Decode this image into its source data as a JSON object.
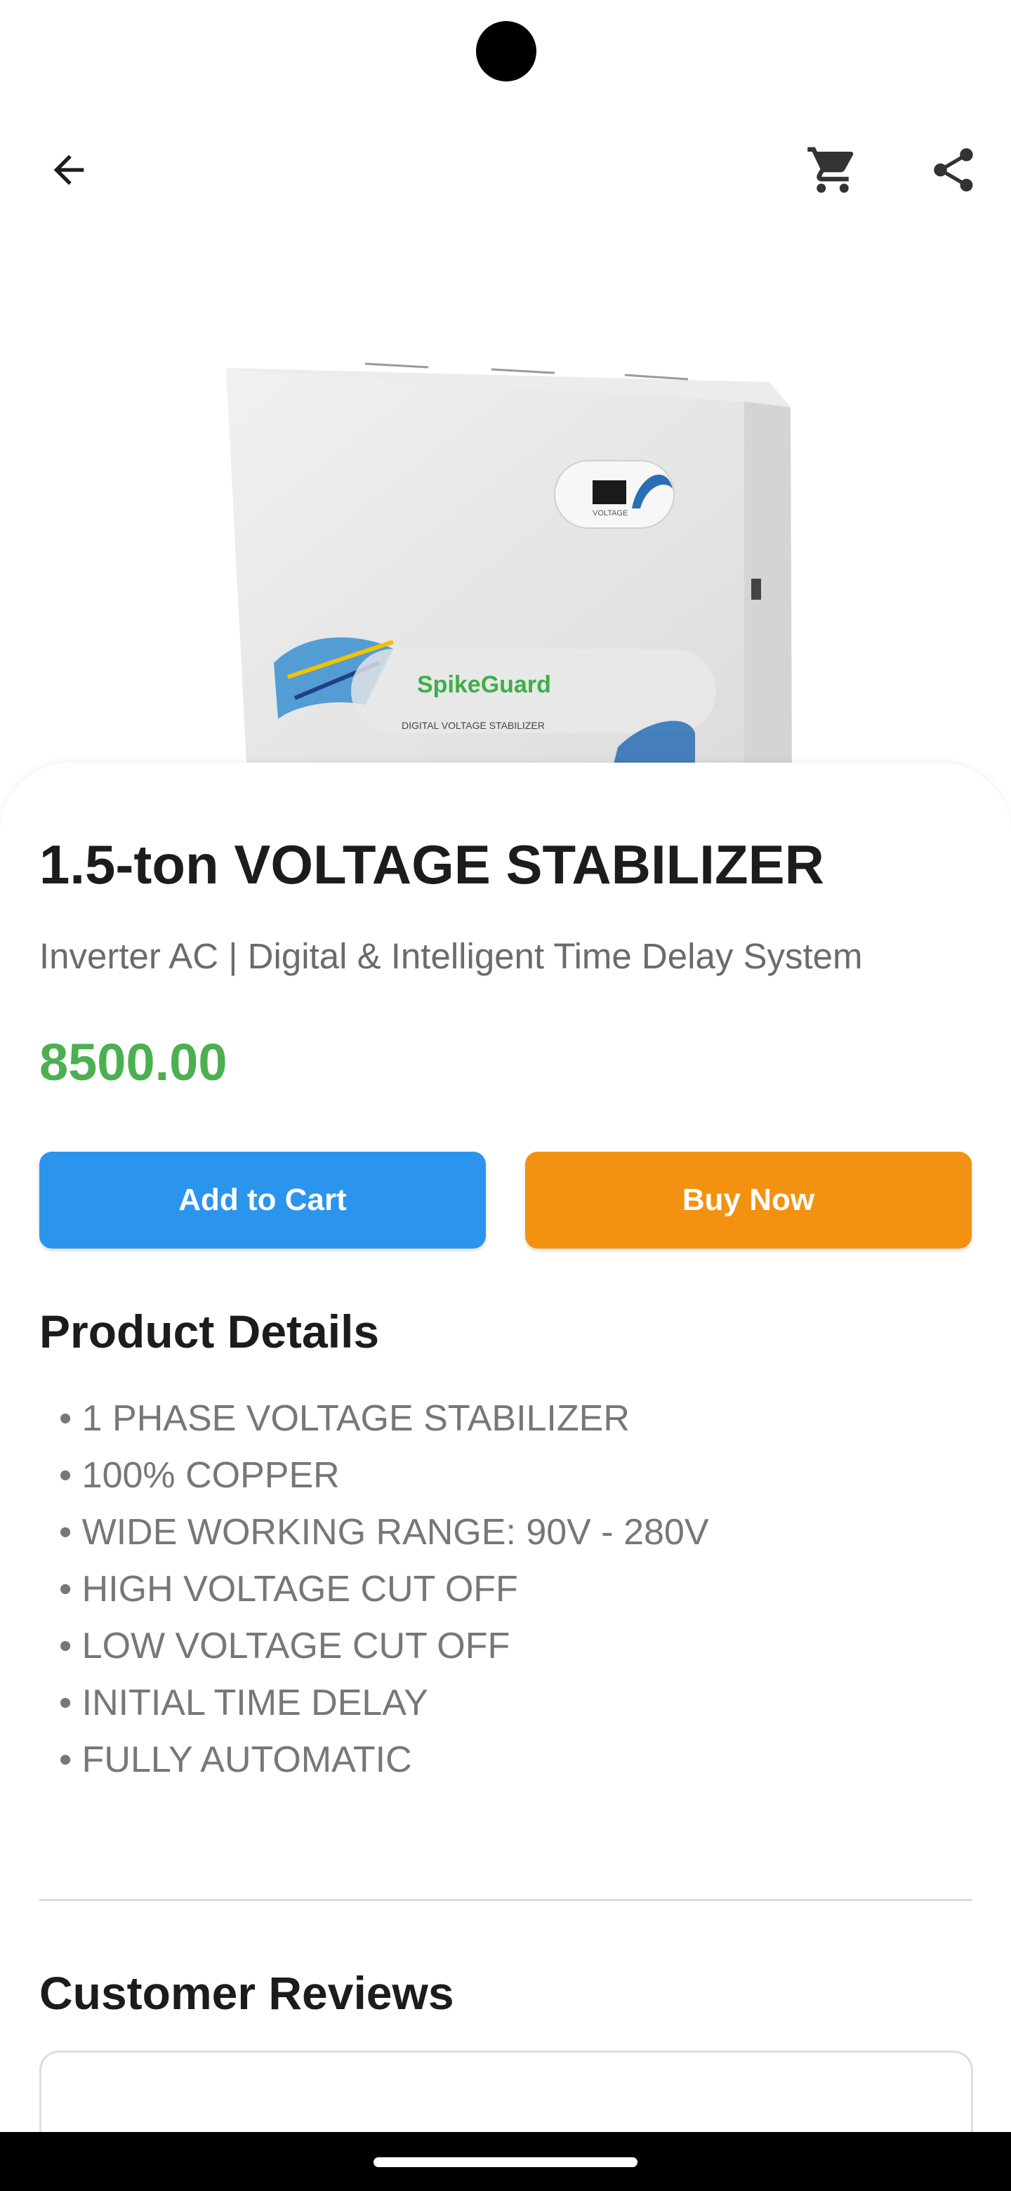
{
  "header": {
    "back_icon": "arrow-back-icon",
    "cart_icon": "shopping-cart-icon",
    "share_icon": "share-icon"
  },
  "product": {
    "image_brand": "SpikeGuard",
    "image_caption": "DIGITAL VOLTAGE STABILIZER",
    "image_panel_label": "VOLTAGE",
    "title": "1.5-ton VOLTAGE STABILIZER",
    "subtitle": "Inverter AC | Digital & Intelligent Time Delay System",
    "price": "8500.00"
  },
  "actions": {
    "add_to_cart": "Add to Cart",
    "buy_now": "Buy Now"
  },
  "details": {
    "title": "Product Details",
    "items": [
      "• 1 PHASE VOLTAGE STABILIZER",
      "• 100% COPPER",
      "• WIDE WORKING RANGE: 90V - 280V",
      "• HIGH VOLTAGE CUT OFF",
      "• LOW VOLTAGE CUT OFF",
      "• INITIAL TIME DELAY",
      "• FULLY AUTOMATIC"
    ]
  },
  "reviews": {
    "title": "Customer Reviews"
  },
  "colors": {
    "price": "#4caf50",
    "add_to_cart": "#2b95ee",
    "buy_now": "#f39211"
  }
}
